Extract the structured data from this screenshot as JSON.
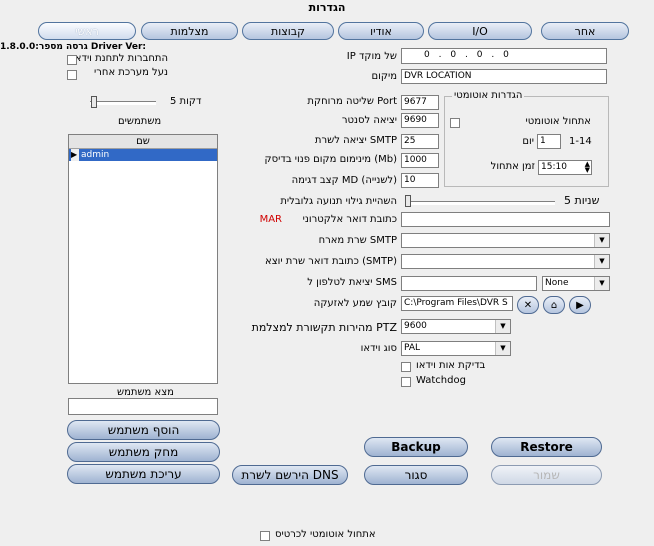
{
  "window": {
    "title": "הגדרות"
  },
  "tabs": [
    {
      "label": "אחר"
    },
    {
      "label": "I/O"
    },
    {
      "label": "אודיו"
    },
    {
      "label": "קבוצות"
    },
    {
      "label": "מצלמות"
    },
    {
      "label": "ראשי"
    }
  ],
  "left": {
    "driver_ver": "1.8.0.0:גרסה מספר Driver Ver:",
    "priority_video": "התחברות לתחנת וידאו",
    "lock_system": "נעל מערכת אחרי",
    "minutes": "דקות 5",
    "users_title": "משתמשים",
    "users_col": "שם",
    "users": [
      "admin"
    ],
    "find_user": "מצא משתמש",
    "find_value": "",
    "add_user": "הוסף משתמש",
    "delete_user": "מחק משתמש",
    "edit_user": "עריכת משתמש"
  },
  "main": {
    "ip_label": "IP של מוקד",
    "ip_values": [
      "0",
      "0",
      "0",
      "0"
    ],
    "location_label": "מיקום",
    "location_value": "DVR LOCATION",
    "remote_port_label": "שליטה מרוחקת Port",
    "remote_port_value": "9677",
    "sensor_out_label": "יציאה לסנטר",
    "sensor_out_value": "9690",
    "smtp_out_label": "יציאה לשרת SMTP",
    "smtp_out_value": "25",
    "min_disk_label": "מינימום מקום פנוי בדיסק (Mb)",
    "min_disk_value": "1000",
    "md_rate_label": "קצב דגימה MD (לשנייה)",
    "md_rate_value": "10",
    "hold_label": "השהיית גילוי תנועה גלובלית",
    "hold_value": "שניות 5",
    "email_label": "כתובת דואר אלקטרוני",
    "email_prefix": "MAR",
    "email_value": "",
    "smtp_host_label": "שרת מארח SMTP",
    "smtp_host_value": "",
    "smtp_sender_label": "כתובת דואר שרת יוצא (SMTP)",
    "smtp_sender_value": "",
    "sms_label": "יציאת לטלפון ל SMS",
    "sms_value": "",
    "sms_mode": "None",
    "alarm_file_label": "קובץ שמע לאזעקה",
    "alarm_file_value": "C:\\Program Files\\DVR S",
    "ptz_label": "מהירות תקשורת למצלמת PTZ",
    "ptz_value": "9600",
    "video_type_label": "סוג וידאו",
    "video_type_value": "PAL",
    "video_check_label": "בדיקת אות וידאו",
    "watchdog_label": "Watchdog"
  },
  "auto_settings": {
    "title": "הגדרות אוטומטי",
    "auto_restart": "אתחול אוטומטי",
    "day_label": "יום",
    "day_value": "1",
    "day_range": "1-14",
    "time_label": "זמן אתחול",
    "time_value": "15:10"
  },
  "buttons": {
    "backup": "Backup",
    "restore": "Restore",
    "dns": "הירשם לשרת DNS",
    "close": "סגור",
    "save": "שמור",
    "startup": "אתחול אוטומטי לכרטיס"
  }
}
